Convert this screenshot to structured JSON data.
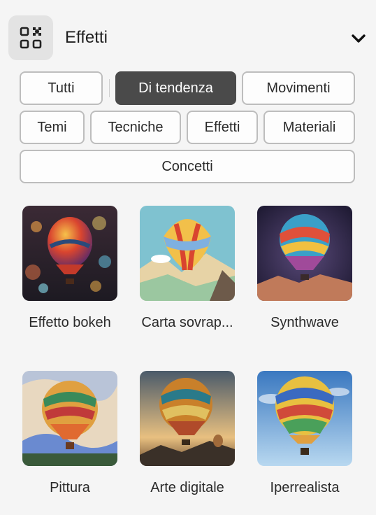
{
  "header": {
    "title": "Effetti",
    "icon": "effects-grid-icon",
    "toggle_icon": "chevron-down-icon"
  },
  "filters": [
    {
      "label": "Tutti",
      "active": false
    },
    {
      "label": "Di tendenza",
      "active": true
    },
    {
      "label": "Movimenti",
      "active": false
    },
    {
      "label": "Temi",
      "active": false
    },
    {
      "label": "Tecniche",
      "active": false
    },
    {
      "label": "Effetti",
      "active": false
    },
    {
      "label": "Materiali",
      "active": false
    },
    {
      "label": "Concetti",
      "active": false
    }
  ],
  "styles": [
    {
      "label": "Effetto bokeh"
    },
    {
      "label": "Carta sovrap..."
    },
    {
      "label": "Synthwave"
    },
    {
      "label": "Pittura"
    },
    {
      "label": "Arte digitale"
    },
    {
      "label": "Iperrealista"
    }
  ],
  "colors": {
    "active_chip": "#4a4a4a",
    "chip_border": "#bdbdbd",
    "panel_bg": "#f5f5f5"
  }
}
